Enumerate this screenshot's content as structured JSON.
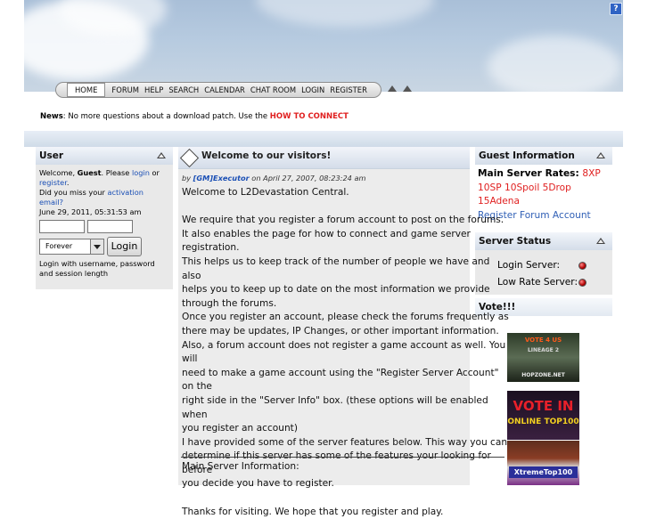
{
  "header": {
    "help_icon": "?"
  },
  "nav": {
    "items": [
      "HOME",
      "FORUM",
      "HELP",
      "SEARCH",
      "CALENDAR",
      "CHAT ROOM",
      "LOGIN",
      "REGISTER"
    ]
  },
  "news": {
    "label": "News",
    "text": ": No more questions about a download patch. Use the ",
    "link": "HOW TO CONNECT"
  },
  "user": {
    "title": "User",
    "welcome_pre": "Welcome, ",
    "guest": "Guest",
    "please": ". Please ",
    "login_link": "login",
    "or": " or",
    "register_link": "register",
    "period": ".",
    "missed": "Did you miss your ",
    "activation_link": "activation email?",
    "datetime": "June 29, 2011, 05:31:53 am",
    "select_value": "Forever",
    "login_button": "Login",
    "hint": "Login with username, password and session length"
  },
  "article": {
    "title": "Welcome to our visitors!",
    "by": "by ",
    "author": "[GM]Executor",
    "date": " on April 27, 2007, 08:23:24 am",
    "paragraphs": [
      "Welcome to L2Devastation Central.",
      "",
      "We require that you register a forum account to post on the forums.",
      "It also enables the page for how to connect and game server registration.",
      "This helps us to keep track of the number of people we have and also",
      "helps you to keep up to date on the most information we provide",
      "through the forums.",
      "Once you register an account, please check the forums frequently as",
      "there may be updates, IP Changes, or other important information.",
      "Also, a forum account does not register a game account as well.  You will",
      "need to make a game account using the \"Register Server Account\" on the",
      "right side in the \"Server Info\" box.  (these options will be enabled when",
      "you register an account)",
      "I have provided some of the server features below.  This way you can",
      "determine if this server has some of the features your looking for before",
      "you decide you have to register.",
      "",
      "Thanks for visiting.  We hope that you register and play."
    ],
    "main_info": "Main Server Information:"
  },
  "guest_info": {
    "title": "Guest Information",
    "rates_label": "Main Server Rates: ",
    "rates_1": "8XP",
    "rates_2": "10SP 10Spoil 5Drop",
    "rates_3": "15Adena",
    "register_link": "Register Forum Account"
  },
  "server_status": {
    "title": "Server Status",
    "rows": [
      "Login Server:",
      "Low Rate Server:"
    ]
  },
  "vote": {
    "title": "Vote!!!",
    "banner1_text": "VOTE 4 US",
    "banner1_sub": "LINEAGE 2",
    "banner1_site": "HOPZONE.NET",
    "banner2_line1": "VOTE IN",
    "banner2_line2": "ONLINE TOP100",
    "banner3_text": "XtremeTop100"
  },
  "colors": {
    "accent_red": "#e02020",
    "link_blue": "#1a4fb5"
  }
}
